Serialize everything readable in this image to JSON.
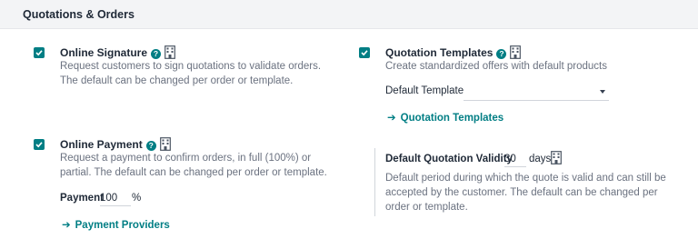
{
  "section": {
    "title": "Quotations & Orders"
  },
  "online_signature": {
    "label": "Online Signature",
    "checked": true,
    "help": "?",
    "description": "Request customers to sign quotations to validate orders. The default can be changed per order or template."
  },
  "quotation_templates": {
    "label": "Quotation Templates",
    "checked": true,
    "help": "?",
    "description": "Create standardized offers with default products",
    "default_template_label": "Default Template",
    "default_template_value": "",
    "link_label": "Quotation Templates"
  },
  "online_payment": {
    "label": "Online Payment",
    "checked": true,
    "help": "?",
    "description": "Request a payment to confirm orders, in full (100%) or partial. The default can be changed per order or template.",
    "payment_label": "Payment",
    "payment_value": "100",
    "payment_unit": "%",
    "link_label": "Payment Providers"
  },
  "quotation_validity": {
    "label": "Default Quotation Validity",
    "value": "30",
    "unit": "days",
    "description": "Default period during which the quote is valid and can still be accepted by the customer. The default can be changed per order or template."
  },
  "icons": {
    "help": "question-circle-icon",
    "company_setting": "building-icon",
    "arrow": "arrow-right-icon",
    "check": "check-icon"
  },
  "colors": {
    "accent": "#017e84",
    "header_bg": "#f3f4f6"
  }
}
